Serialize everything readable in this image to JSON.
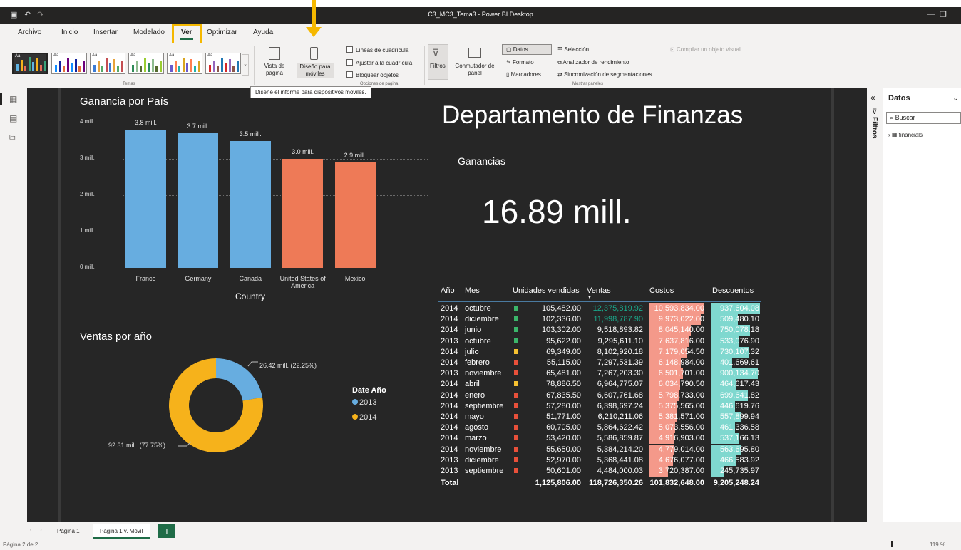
{
  "window": {
    "title": "C3_MC3_Tema3 - Power BI Desktop"
  },
  "ribbon_tabs": [
    "Archivo",
    "Inicio",
    "Insertar",
    "Modelado",
    "Ver",
    "Optimizar",
    "Ayuda"
  ],
  "ribbon": {
    "themes_label": "Temas",
    "theme_sample": "Aa",
    "vista_pagina": "Vista de página",
    "diseno_moviles": "Diseño para móviles",
    "lineas_cuadricula": "Líneas de cuadrícula",
    "ajustar_cuadricula": "Ajustar a la cuadrícula",
    "bloquear_objetos": "Bloquear objetos",
    "opciones_pagina": "Opciones de página",
    "filtros": "Filtros",
    "conmutador_panel": "Conmutador de panel",
    "datos": "Datos",
    "formato": "Formato",
    "marcadores": "Marcadores",
    "seleccion": "Selección",
    "analizador": "Analizador de rendimiento",
    "sincronizacion": "Sincronización de segmentaciones",
    "compilar": "Compilar un objeto visual",
    "mostrar_paneles": "Mostrar paneles",
    "tooltip": "Diseñe el informe para dispositivos móviles."
  },
  "colors": {
    "accent": "#f5b800",
    "bar_blue": "#67ade0",
    "bar_orange": "#ee7a57",
    "donut_blue": "#67ade0",
    "donut_orange": "#f6b21b",
    "costos_bar": "#f4998a",
    "descuentos_bar": "#7fd8cf",
    "positive_green": "#1aa88b"
  },
  "report": {
    "title": "Departamento de Finanzas",
    "card": {
      "label": "Ganancias",
      "value": "16.89 mill."
    }
  },
  "chart_data": [
    {
      "type": "bar",
      "title": "Ganancia por País",
      "xlabel": "Country",
      "categories": [
        "France",
        "Germany",
        "Canada",
        "United States of America",
        "Mexico"
      ],
      "values": [
        3.8,
        3.7,
        3.5,
        3.0,
        2.9
      ],
      "data_labels": [
        "3.8 mill.",
        "3.7 mill.",
        "3.5 mill.",
        "3.0 mill.",
        "2.9 mill."
      ],
      "y_ticks": [
        "0 mill.",
        "1 mill.",
        "2 mill.",
        "3 mill.",
        "4 mill."
      ],
      "ylim": [
        0,
        4
      ],
      "bar_colors": [
        "#67ade0",
        "#67ade0",
        "#67ade0",
        "#ee7a57",
        "#ee7a57"
      ]
    },
    {
      "type": "pie",
      "title": "Ventas por año",
      "legend_title": "Date Año",
      "series": [
        {
          "name": "2013",
          "value": 26.42,
          "label": "26.42 mill. (22.25%)",
          "color": "#67ade0"
        },
        {
          "name": "2014",
          "value": 92.31,
          "label": "92.31 mill. (77.75%)",
          "color": "#f6b21b"
        }
      ]
    },
    {
      "type": "table",
      "columns": [
        "Año",
        "Mes",
        "Unidades vendidas",
        "Ventas",
        "Costos",
        "Descuentos"
      ],
      "rows": [
        {
          "year": "2014",
          "month": "octubre",
          "units": "105,482.00",
          "flag": "green",
          "ventas": "12,375,819.92",
          "costos": "10,593,834.00",
          "descuentos": "937,604.08",
          "costos_frac": 1.0,
          "desc_frac": 1.0,
          "ventas_color": "#1aa88b"
        },
        {
          "year": "2014",
          "month": "diciembre",
          "units": "102,336.00",
          "flag": "green",
          "ventas": "11,998,787.90",
          "costos": "9,973,022.00",
          "descuentos": "509,480.10",
          "costos_frac": 0.94,
          "desc_frac": 0.54,
          "ventas_color": "#1aa88b"
        },
        {
          "year": "2014",
          "month": "junio",
          "units": "103,302.00",
          "flag": "green",
          "ventas": "9,518,893.82",
          "costos": "8,045,140.00",
          "descuentos": "750,078.18",
          "costos_frac": 0.76,
          "desc_frac": 0.8,
          "ventas_color": "#ffffff"
        },
        {
          "year": "2013",
          "month": "octubre",
          "units": "95,622.00",
          "flag": "green",
          "ventas": "9,295,611.10",
          "costos": "7,637,816.00",
          "descuentos": "533,076.90",
          "costos_frac": 0.72,
          "desc_frac": 0.57,
          "ventas_color": "#ffffff"
        },
        {
          "year": "2014",
          "month": "julio",
          "units": "69,349.00",
          "flag": "yellow",
          "ventas": "8,102,920.18",
          "costos": "7,179,054.50",
          "descuentos": "730,107.32",
          "costos_frac": 0.68,
          "desc_frac": 0.78,
          "ventas_color": "#ffffff"
        },
        {
          "year": "2014",
          "month": "febrero",
          "units": "55,115.00",
          "flag": "red",
          "ventas": "7,297,531.39",
          "costos": "6,148,984.00",
          "descuentos": "401,669.61",
          "costos_frac": 0.58,
          "desc_frac": 0.43,
          "ventas_color": "#ffffff"
        },
        {
          "year": "2013",
          "month": "noviembre",
          "units": "65,481.00",
          "flag": "red",
          "ventas": "7,267,203.30",
          "costos": "6,501,701.00",
          "descuentos": "900,134.70",
          "costos_frac": 0.61,
          "desc_frac": 0.96,
          "ventas_color": "#ffffff"
        },
        {
          "year": "2014",
          "month": "abril",
          "units": "78,886.50",
          "flag": "yellow",
          "ventas": "6,964,775.07",
          "costos": "6,034,790.50",
          "descuentos": "464,617.43",
          "costos_frac": 0.57,
          "desc_frac": 0.5,
          "ventas_color": "#ffffff"
        },
        {
          "year": "2014",
          "month": "enero",
          "units": "67,835.50",
          "flag": "red",
          "ventas": "6,607,761.68",
          "costos": "5,798,733.00",
          "descuentos": "699,641.82",
          "costos_frac": 0.55,
          "desc_frac": 0.75,
          "ventas_color": "#ffffff"
        },
        {
          "year": "2014",
          "month": "septiembre",
          "units": "57,280.00",
          "flag": "red",
          "ventas": "6,398,697.24",
          "costos": "5,375,565.00",
          "descuentos": "446,619.76",
          "costos_frac": 0.51,
          "desc_frac": 0.48,
          "ventas_color": "#ffffff"
        },
        {
          "year": "2014",
          "month": "mayo",
          "units": "51,771.00",
          "flag": "red",
          "ventas": "6,210,211.06",
          "costos": "5,381,571.00",
          "descuentos": "557,899.94",
          "costos_frac": 0.51,
          "desc_frac": 0.6,
          "ventas_color": "#ffffff"
        },
        {
          "year": "2014",
          "month": "agosto",
          "units": "60,705.00",
          "flag": "red",
          "ventas": "5,864,622.42",
          "costos": "5,073,556.00",
          "descuentos": "461,336.58",
          "costos_frac": 0.48,
          "desc_frac": 0.49,
          "ventas_color": "#ffffff"
        },
        {
          "year": "2014",
          "month": "marzo",
          "units": "53,420.00",
          "flag": "red",
          "ventas": "5,586,859.87",
          "costos": "4,916,903.00",
          "descuentos": "537,166.13",
          "costos_frac": 0.46,
          "desc_frac": 0.57,
          "ventas_color": "#ffffff"
        },
        {
          "year": "2014",
          "month": "noviembre",
          "units": "55,650.00",
          "flag": "red",
          "ventas": "5,384,214.20",
          "costos": "4,779,014.00",
          "descuentos": "563,695.80",
          "costos_frac": 0.45,
          "desc_frac": 0.6,
          "ventas_color": "#ffffff"
        },
        {
          "year": "2013",
          "month": "diciembre",
          "units": "52,970.00",
          "flag": "red",
          "ventas": "5,368,441.08",
          "costos": "4,676,077.00",
          "descuentos": "466,583.92",
          "costos_frac": 0.44,
          "desc_frac": 0.5,
          "ventas_color": "#ffffff"
        },
        {
          "year": "2013",
          "month": "septiembre",
          "units": "50,601.00",
          "flag": "red",
          "ventas": "4,484,000.03",
          "costos": "3,720,387.00",
          "descuentos": "245,735.97",
          "costos_frac": 0.35,
          "desc_frac": 0.26,
          "ventas_color": "#ffffff"
        }
      ],
      "total": {
        "label": "Total",
        "units": "1,125,806.00",
        "ventas": "118,726,350.26",
        "costos": "101,832,648.00",
        "descuentos": "9,205,248.24"
      }
    }
  ],
  "panes": {
    "filters_label": "Filtros",
    "data_title": "Datos",
    "search_placeholder": "Buscar",
    "field_table": "financials"
  },
  "pages": [
    "Página 1",
    "Página 1 v. Móvil"
  ],
  "status": {
    "page_info": "Página 2 de 2",
    "zoom": "119 %"
  }
}
